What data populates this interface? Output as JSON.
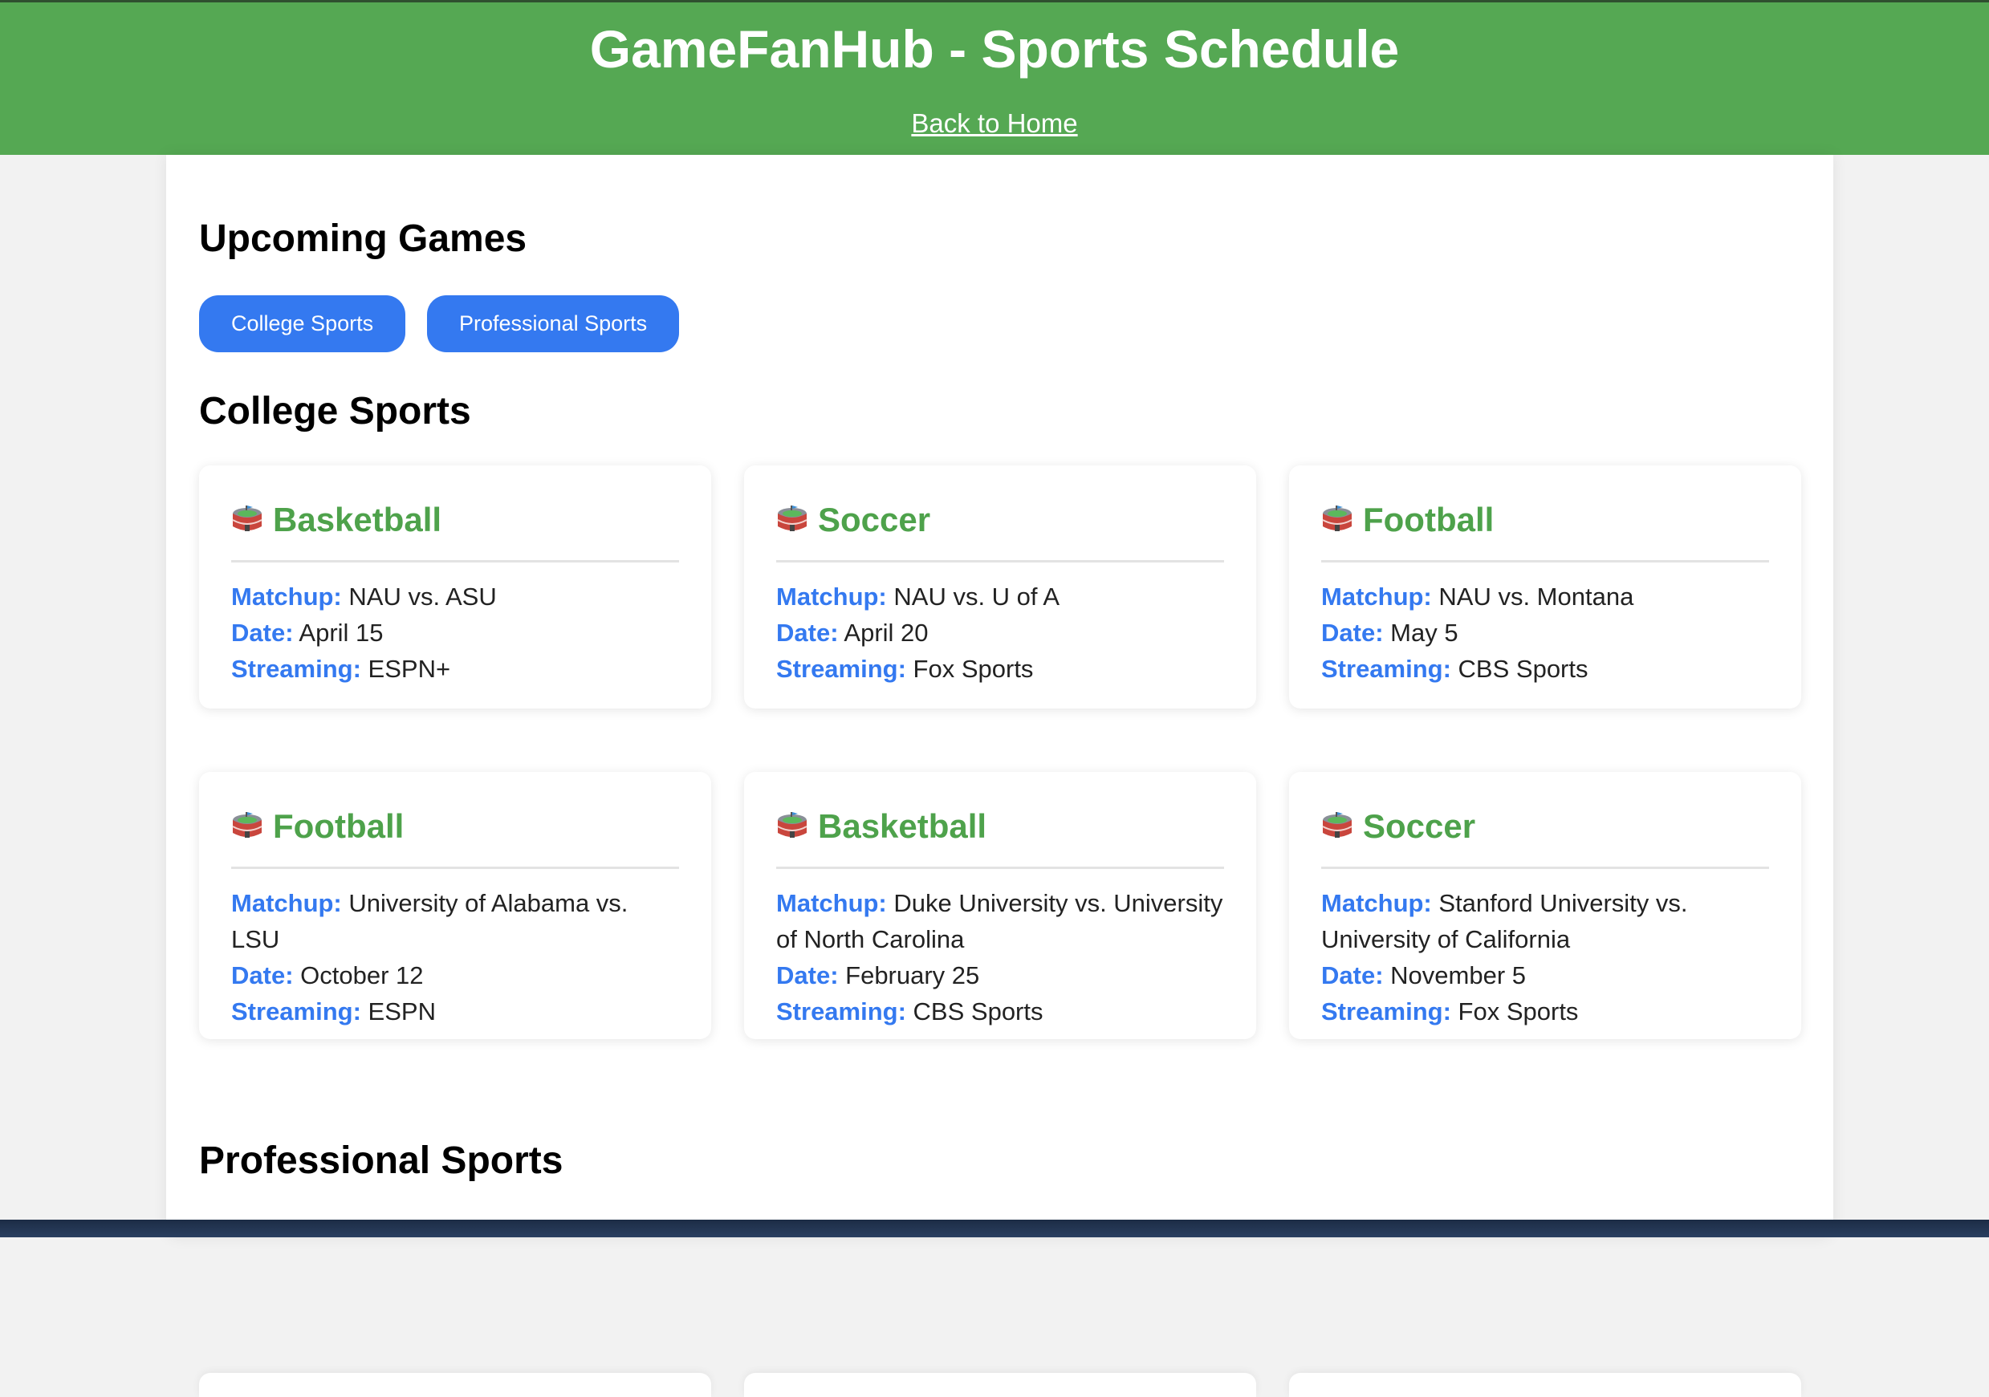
{
  "header": {
    "title": "GameFanHub - Sports Schedule",
    "back_link": "Back to Home"
  },
  "main": {
    "upcoming_title": "Upcoming Games",
    "filters": [
      "College Sports",
      "Professional Sports"
    ],
    "college_title": "College Sports",
    "professional_title": "Professional Sports",
    "labels": {
      "matchup": "Matchup:",
      "date": "Date:",
      "streaming": "Streaming:"
    },
    "college_games": [
      {
        "sport": "Basketball",
        "matchup": "NAU vs. ASU",
        "date": "April 15",
        "streaming": "ESPN+"
      },
      {
        "sport": "Soccer",
        "matchup": "NAU vs. U of A",
        "date": "April 20",
        "streaming": "Fox Sports"
      },
      {
        "sport": "Football",
        "matchup": "NAU vs. Montana",
        "date": "May 5",
        "streaming": "CBS Sports"
      },
      {
        "sport": "Football",
        "matchup": "University of Alabama vs. LSU",
        "date": "October 12",
        "streaming": "ESPN"
      },
      {
        "sport": "Basketball",
        "matchup": "Duke University vs. University of North Carolina",
        "date": "February 25",
        "streaming": "CBS Sports"
      },
      {
        "sport": "Soccer",
        "matchup": "Stanford University vs. University of California",
        "date": "November 5",
        "streaming": "Fox Sports"
      }
    ],
    "card_icon": "stadium-icon"
  },
  "colors": {
    "header_bg": "#55a853",
    "button_bg": "#3479f0",
    "sport_title": "#4ea24b",
    "label": "#3479f0"
  }
}
